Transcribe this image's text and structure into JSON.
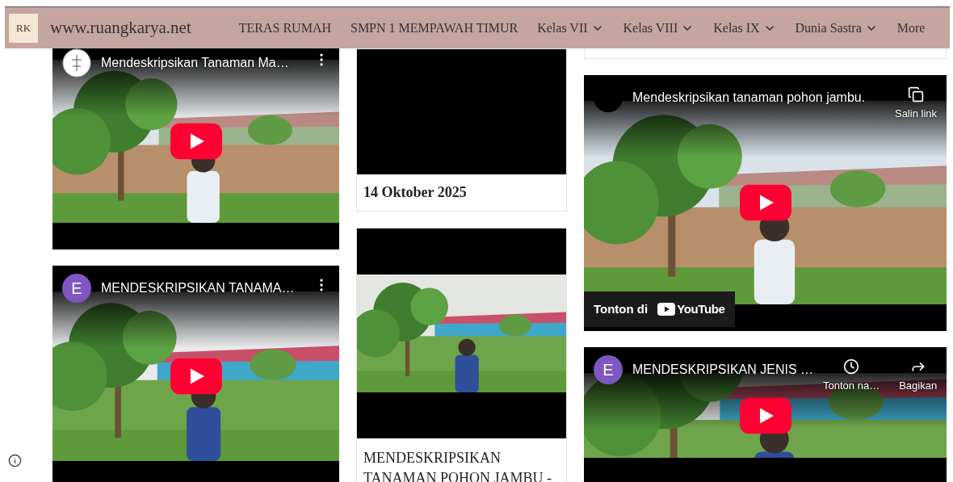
{
  "header": {
    "logo": "RK",
    "title": "www.ruangkarya.net"
  },
  "nav": [
    {
      "label": "TERAS RUMAH",
      "kind": "link"
    },
    {
      "label": "SMPN 1 MEMPAWAH TIMUR",
      "kind": "link"
    },
    {
      "label": "Kelas VII",
      "kind": "dropdown"
    },
    {
      "label": "Kelas VIII",
      "kind": "dropdown"
    },
    {
      "label": "Kelas IX",
      "kind": "dropdown"
    },
    {
      "label": "Dunia Sastra",
      "kind": "dropdown"
    },
    {
      "label": "More",
      "kind": "link"
    }
  ],
  "columns": [
    [
      {
        "kind": "video",
        "avatar": {
          "kind": "picture"
        },
        "title": "Mendeskripsikan Tanaman Ma…",
        "actions": [
          {
            "kind": "menu"
          }
        ]
      },
      {
        "kind": "video",
        "avatar": {
          "kind": "letter",
          "letter": "E",
          "color": "#7e57c2"
        },
        "title": "MENDESKRIPSIKAN TANAMA…",
        "actions": [
          {
            "kind": "menu"
          }
        ]
      }
    ],
    [
      {
        "kind": "date_card",
        "caption": "14 Oktober 2025"
      },
      {
        "kind": "video_post",
        "caption": "MENDESKRIPSIKAN TANAMAN POHON JAMBU -"
      }
    ],
    [
      {
        "kind": "card_end"
      },
      {
        "kind": "video",
        "avatar": {
          "kind": "blank"
        },
        "title": "Mendeskripsikan tanaman pohon jambu.",
        "actions": [
          {
            "kind": "copy",
            "label": "Salin link"
          }
        ],
        "watch": {
          "label": "Tonton di",
          "logo": "YouTube"
        }
      },
      {
        "kind": "video",
        "avatar": {
          "kind": "letter",
          "letter": "E",
          "color": "#7e57c2"
        },
        "title": "MENDESKRIPSIKAN JENIS …",
        "actions": [
          {
            "kind": "clock",
            "label": "Tonton na…"
          },
          {
            "kind": "share",
            "label": "Bagikan"
          }
        ]
      }
    ]
  ],
  "info_button": {
    "kind": "info"
  }
}
